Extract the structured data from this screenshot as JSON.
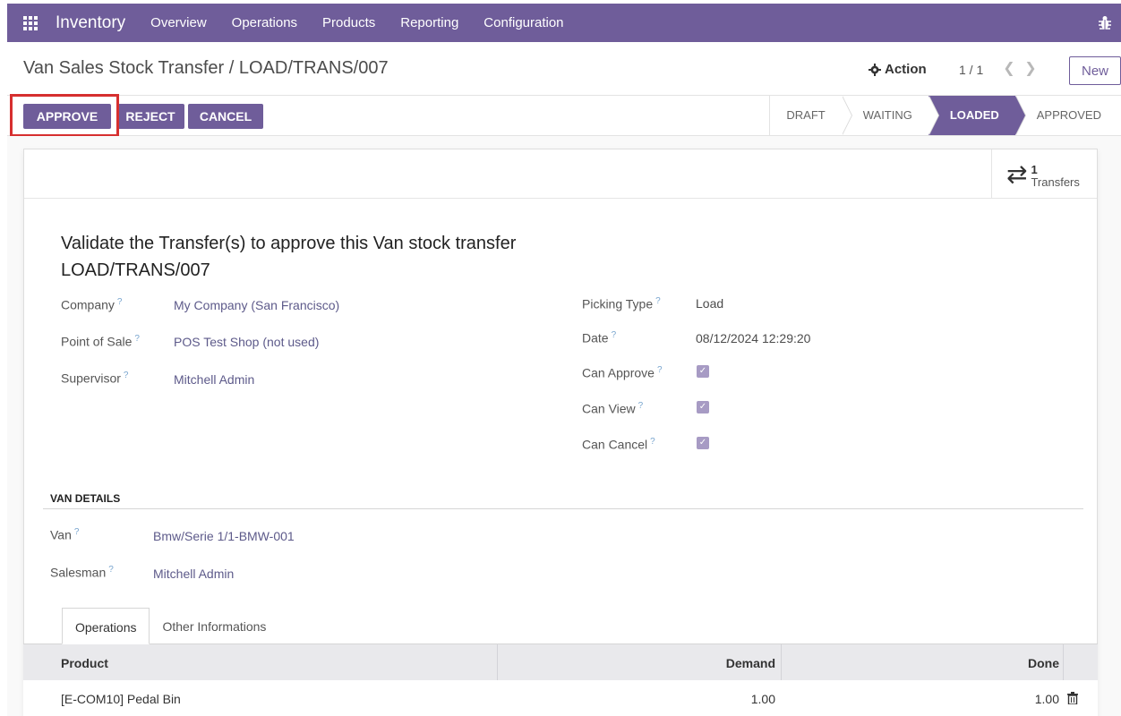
{
  "navbar": {
    "app_name": "Inventory",
    "menu": [
      "Overview",
      "Operations",
      "Products",
      "Reporting",
      "Configuration"
    ]
  },
  "control_panel": {
    "breadcrumb": "Van Sales Stock Transfer / LOAD/TRANS/007",
    "action_label": "Action",
    "pager": "1 / 1",
    "new_label": "New"
  },
  "statusbar": {
    "buttons": {
      "approve": "APPROVE",
      "reject": "REJECT",
      "cancel": "CANCEL"
    },
    "stages": [
      "DRAFT",
      "WAITING",
      "LOADED",
      "APPROVED"
    ],
    "active_stage": "LOADED"
  },
  "smart_button": {
    "count": "1",
    "label": "Transfers"
  },
  "form": {
    "title": "Validate the Transfer(s) to approve this Van stock transfer LOAD/TRANS/007",
    "help_mark": "?",
    "left_fields": [
      {
        "label": "Company",
        "value": "My Company (San Francisco)"
      },
      {
        "label": "Point of Sale",
        "value": "POS Test Shop (not used)"
      },
      {
        "label": "Supervisor",
        "value": "Mitchell Admin"
      }
    ],
    "right_fields": [
      {
        "label": "Picking Type",
        "value": "Load"
      },
      {
        "label": "Date",
        "value": "08/12/2024 12:29:20"
      },
      {
        "label": "Can Approve",
        "checked": true
      },
      {
        "label": "Can View",
        "checked": true
      },
      {
        "label": "Can Cancel",
        "checked": true
      }
    ],
    "van_section": {
      "title": "VAN DETAILS",
      "fields": [
        {
          "label": "Van",
          "value": "Bmw/Serie 1/1-BMW-001"
        },
        {
          "label": "Salesman",
          "value": "Mitchell Admin"
        }
      ]
    }
  },
  "tabs": [
    "Operations",
    "Other Informations"
  ],
  "table": {
    "columns": [
      "Product",
      "Demand",
      "Done"
    ],
    "rows": [
      {
        "product": "[E-COM10] Pedal Bin",
        "demand": "1.00",
        "done": "1.00"
      }
    ]
  },
  "colors": {
    "brand": "#6f5d9a",
    "highlight": "#d62f2f"
  }
}
